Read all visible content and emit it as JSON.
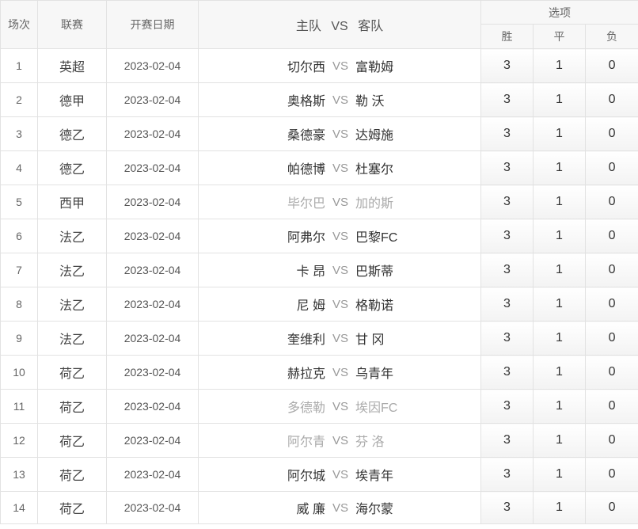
{
  "header": {
    "no": "场次",
    "league": "联赛",
    "date": "开赛日期",
    "home": "主队",
    "vs": "VS",
    "away": "客队",
    "options": "选项",
    "win": "胜",
    "draw": "平",
    "loss": "负"
  },
  "rows": [
    {
      "no": "1",
      "league": "英超",
      "date": "2023-02-04",
      "home": "切尔西",
      "vs": "VS",
      "away": "富勒姆",
      "win": "3",
      "draw": "1",
      "loss": "0",
      "muted": false
    },
    {
      "no": "2",
      "league": "德甲",
      "date": "2023-02-04",
      "home": "奥格斯",
      "vs": "VS",
      "away": "勒 沃",
      "win": "3",
      "draw": "1",
      "loss": "0",
      "muted": false
    },
    {
      "no": "3",
      "league": "德乙",
      "date": "2023-02-04",
      "home": "桑德豪",
      "vs": "VS",
      "away": "达姆施",
      "win": "3",
      "draw": "1",
      "loss": "0",
      "muted": false
    },
    {
      "no": "4",
      "league": "德乙",
      "date": "2023-02-04",
      "home": "帕德博",
      "vs": "VS",
      "away": "杜塞尔",
      "win": "3",
      "draw": "1",
      "loss": "0",
      "muted": false
    },
    {
      "no": "5",
      "league": "西甲",
      "date": "2023-02-04",
      "home": "毕尔巴",
      "vs": "VS",
      "away": "加的斯",
      "win": "3",
      "draw": "1",
      "loss": "0",
      "muted": true
    },
    {
      "no": "6",
      "league": "法乙",
      "date": "2023-02-04",
      "home": "阿弗尔",
      "vs": "VS",
      "away": "巴黎FC",
      "win": "3",
      "draw": "1",
      "loss": "0",
      "muted": false
    },
    {
      "no": "7",
      "league": "法乙",
      "date": "2023-02-04",
      "home": "卡 昂",
      "vs": "VS",
      "away": "巴斯蒂",
      "win": "3",
      "draw": "1",
      "loss": "0",
      "muted": false
    },
    {
      "no": "8",
      "league": "法乙",
      "date": "2023-02-04",
      "home": "尼 姆",
      "vs": "VS",
      "away": "格勒诺",
      "win": "3",
      "draw": "1",
      "loss": "0",
      "muted": false
    },
    {
      "no": "9",
      "league": "法乙",
      "date": "2023-02-04",
      "home": "奎维利",
      "vs": "VS",
      "away": "甘 冈",
      "win": "3",
      "draw": "1",
      "loss": "0",
      "muted": false
    },
    {
      "no": "10",
      "league": "荷乙",
      "date": "2023-02-04",
      "home": "赫拉克",
      "vs": "VS",
      "away": "乌青年",
      "win": "3",
      "draw": "1",
      "loss": "0",
      "muted": false
    },
    {
      "no": "11",
      "league": "荷乙",
      "date": "2023-02-04",
      "home": "多德勒",
      "vs": "VS",
      "away": "埃因FC",
      "win": "3",
      "draw": "1",
      "loss": "0",
      "muted": true
    },
    {
      "no": "12",
      "league": "荷乙",
      "date": "2023-02-04",
      "home": "阿尔青",
      "vs": "VS",
      "away": "芬 洛",
      "win": "3",
      "draw": "1",
      "loss": "0",
      "muted": true
    },
    {
      "no": "13",
      "league": "荷乙",
      "date": "2023-02-04",
      "home": "阿尔城",
      "vs": "VS",
      "away": "埃青年",
      "win": "3",
      "draw": "1",
      "loss": "0",
      "muted": false
    },
    {
      "no": "14",
      "league": "荷乙",
      "date": "2023-02-04",
      "home": "威 廉",
      "vs": "VS",
      "away": "海尔蒙",
      "win": "3",
      "draw": "1",
      "loss": "0",
      "muted": false
    }
  ]
}
